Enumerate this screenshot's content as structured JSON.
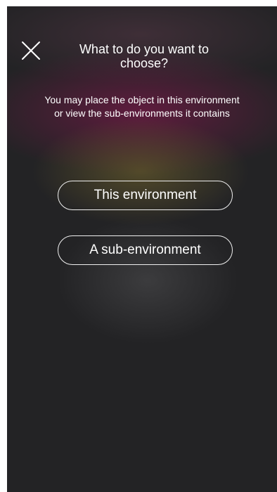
{
  "dialog": {
    "close_icon": "close-icon",
    "title": "What to do you want to\nchoose?",
    "subtitle": "You may place the object in this environment\nor view the sub-environments it contains"
  },
  "options": {
    "this_environment": "This environment",
    "sub_environment": "A sub-environment"
  },
  "colors": {
    "background": "#232325",
    "accent_magenta": "#731946",
    "accent_yellow": "#78692d",
    "text": "#ffffff"
  }
}
